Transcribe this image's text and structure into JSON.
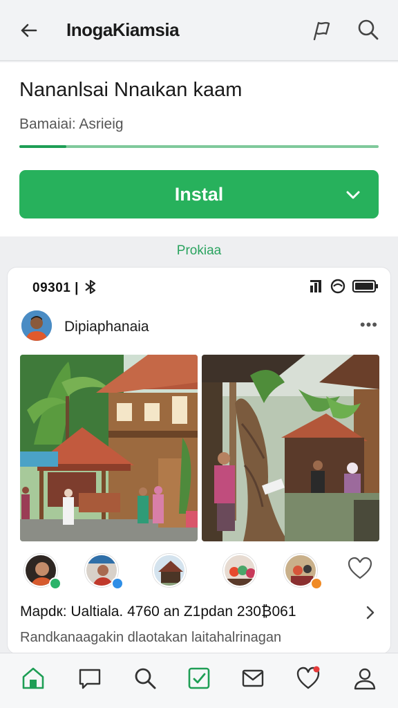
{
  "header": {
    "title": "InogaKiamsia",
    "back_icon": "arrow-left-icon",
    "flag_icon": "flag-icon",
    "search_icon": "search-icon"
  },
  "app": {
    "name": "Nananlsai Nnaιkan kaam",
    "subtitle": "Bamaiai: Asrieig",
    "progress_fraction": 0.13,
    "install_label": "Instal",
    "install_icon": "chevron-down-icon"
  },
  "preview": {
    "label": "Prokiaa",
    "status_time": "09301 | ",
    "status_icons": [
      "bluetooth-icon",
      "signal-icon",
      "wifi-icon",
      "battery-icon"
    ],
    "post_user": "Dipiaphanaia",
    "more_label": "•••",
    "meta_line": "Mapdк: Ualtiala. 4760 an   Z1pdan  230₿061",
    "description": "Randkanaagakin dlaotakan  laitahalrinagan",
    "story_icons": [
      "avatar-woman",
      "avatar-group",
      "house-thumbnail",
      "avatar-people",
      "avatar-family"
    ],
    "like_icon": "heart-outline-icon"
  },
  "bottom_nav": {
    "items": [
      "home-icon",
      "chat-icon",
      "search-icon",
      "check-square-icon",
      "mail-icon",
      "heart-icon",
      "profile-icon"
    ]
  },
  "colors": {
    "accent": "#27b15c",
    "accent_dark": "#1e9e55",
    "background": "#eeeff1",
    "notification": "#e53b3b"
  }
}
